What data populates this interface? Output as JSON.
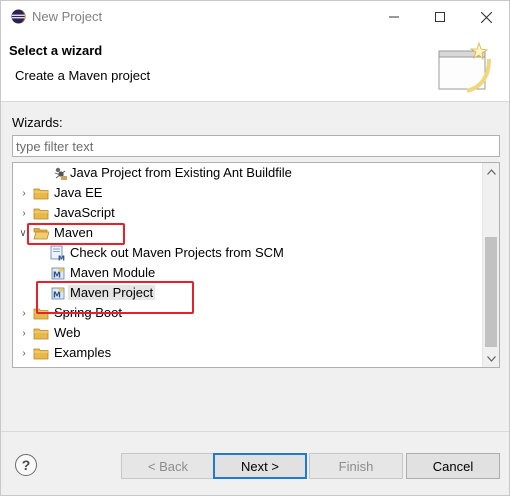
{
  "window": {
    "title": "New Project",
    "minimize_icon": "minimize-icon",
    "maximize_icon": "maximize-icon",
    "close_icon": "close-icon"
  },
  "banner": {
    "title": "Select a wizard",
    "description": "Create a Maven project",
    "art_icon": "wizard-banner-icon"
  },
  "wizards": {
    "label": "Wizards:",
    "filter": {
      "value": "",
      "placeholder": "type filter text"
    },
    "items": [
      {
        "label": "Java Project from Existing Ant Buildfile",
        "icon": "ant-project-icon",
        "level": 1,
        "expandable": false
      },
      {
        "label": "Java EE",
        "icon": "folder-icon",
        "level": 0,
        "expandable": true,
        "expanded": false
      },
      {
        "label": "JavaScript",
        "icon": "folder-icon",
        "level": 0,
        "expandable": true,
        "expanded": false
      },
      {
        "label": "Maven",
        "icon": "folder-icon",
        "level": 0,
        "expandable": true,
        "expanded": true
      },
      {
        "label": "Check out Maven Projects from SCM",
        "icon": "maven-scm-icon",
        "level": 1,
        "expandable": false
      },
      {
        "label": "Maven Module",
        "icon": "maven-module-icon",
        "level": 1,
        "expandable": false
      },
      {
        "label": "Maven Project",
        "icon": "maven-project-icon",
        "level": 1,
        "expandable": false,
        "selected": true
      },
      {
        "label": "Spring Boot",
        "icon": "folder-icon",
        "level": 0,
        "expandable": true,
        "expanded": false
      },
      {
        "label": "Web",
        "icon": "folder-icon",
        "level": 0,
        "expandable": true,
        "expanded": false
      },
      {
        "label": "Examples",
        "icon": "folder-icon",
        "level": 0,
        "expandable": true,
        "expanded": false
      }
    ]
  },
  "buttons": {
    "help_icon": "help-icon",
    "help_glyph": "?",
    "back": "< Back",
    "next": "Next >",
    "finish": "Finish",
    "cancel": "Cancel"
  },
  "colors": {
    "annotation_red": "#e8202a",
    "default_button_border": "#1e7ad2",
    "folder_yellow": "#e8b84a"
  }
}
